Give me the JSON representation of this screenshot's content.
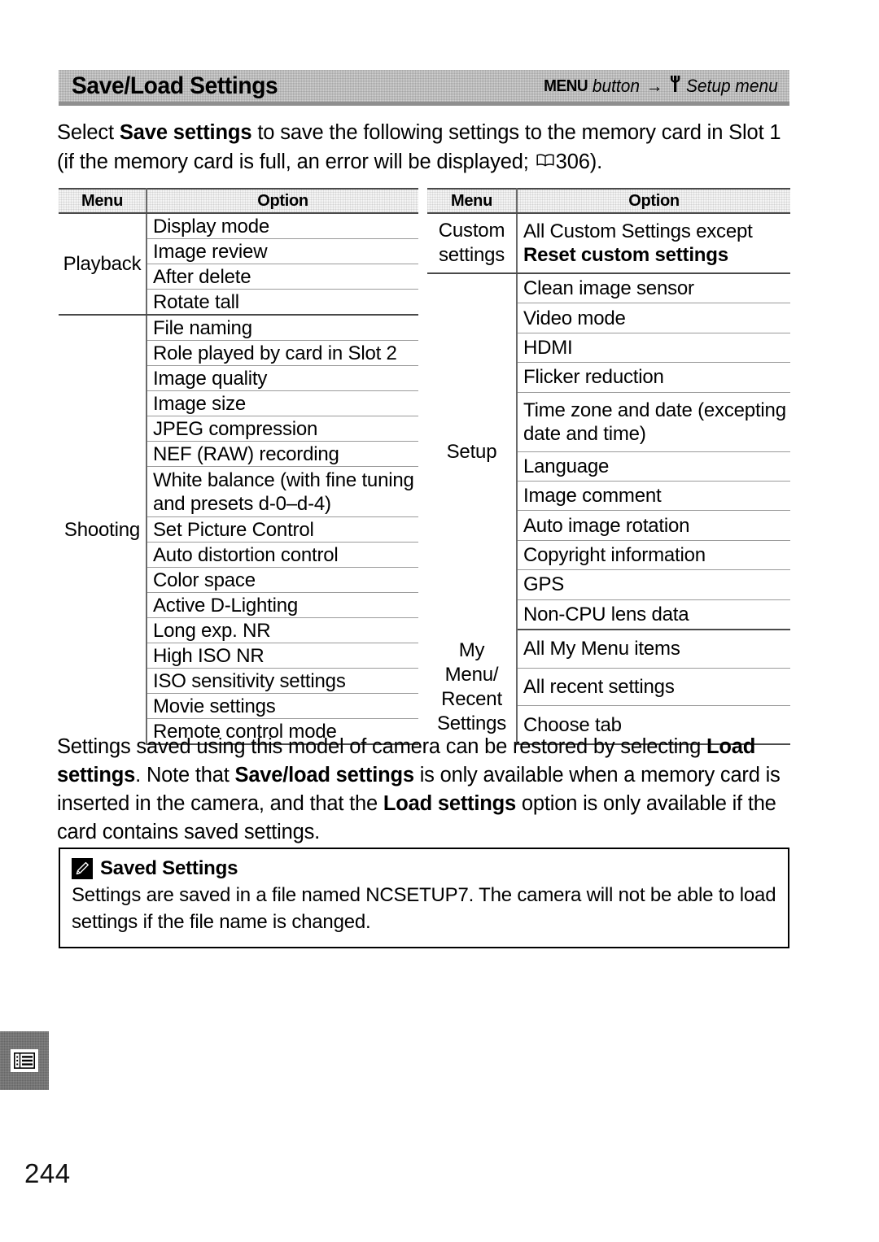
{
  "header": {
    "title": "Save/Load Settings",
    "path": {
      "menu_word": "MENU",
      "button_word": "button",
      "arrow": "→",
      "wrench_icon": "F",
      "destination": "Setup menu"
    }
  },
  "intro": {
    "part1": "Select ",
    "bold1": "Save settings",
    "part2": " to save the following settings to the memory card in Slot 1 (if the memory card is full, an error will be displayed; ",
    "book_icon": "📖",
    "page_ref": "306",
    "part3": ")."
  },
  "tables": {
    "left": {
      "headers": {
        "menu": "Menu",
        "option": "Option"
      },
      "groups": [
        {
          "menu": "Playback",
          "options": [
            "Display mode",
            "Image review",
            "After delete",
            "Rotate tall"
          ]
        },
        {
          "menu": "Shooting",
          "options": [
            "File naming",
            "Role played by card in Slot 2",
            "Image quality",
            "Image size",
            "JPEG compression",
            "NEF (RAW) recording",
            "White balance (with fine tuning and presets d-0–d-4)",
            "Set Picture Control",
            "Auto distortion control",
            "Color space",
            "Active D-Lighting",
            "Long exp.  NR",
            "High ISO NR",
            "ISO sensitivity settings",
            "Movie settings",
            "Remote control mode"
          ]
        }
      ]
    },
    "right": {
      "headers": {
        "menu": "Menu",
        "option": "Option"
      },
      "groups": [
        {
          "menu": "Custom settings",
          "options": [
            "All Custom Settings except Reset custom settings"
          ],
          "option_plain_prefix": "All Custom Settings except ",
          "option_bold_suffix": "Reset custom settings"
        },
        {
          "menu": "Setup",
          "options": [
            "Clean image sensor",
            "Video mode",
            "HDMI",
            "Flicker reduction",
            "Time zone and date (excepting date and time)",
            "Language",
            "Image comment",
            "Auto image rotation",
            "Copyright information",
            "GPS",
            "Non-CPU lens data"
          ]
        },
        {
          "menu": "My Menu/ Recent Settings",
          "options": [
            "All My Menu items",
            "All recent settings",
            "Choose tab"
          ]
        }
      ]
    }
  },
  "body_paragraph": {
    "seg1": "Settings saved using this model of camera can be restored by selecting ",
    "bold1": "Load settings",
    "seg2": ".  Note that ",
    "bold2": "Save/load settings",
    "seg3": " is only available when a memory card is inserted in the camera, and that the ",
    "bold3": "Load settings",
    "seg4": " option is only available if the card contains saved settings."
  },
  "note": {
    "title": "Saved Settings",
    "body": "Settings are saved in a file named NCSETUP7.  The camera will not be able to load settings if the file name is changed."
  },
  "footer": {
    "page_number": "244"
  }
}
